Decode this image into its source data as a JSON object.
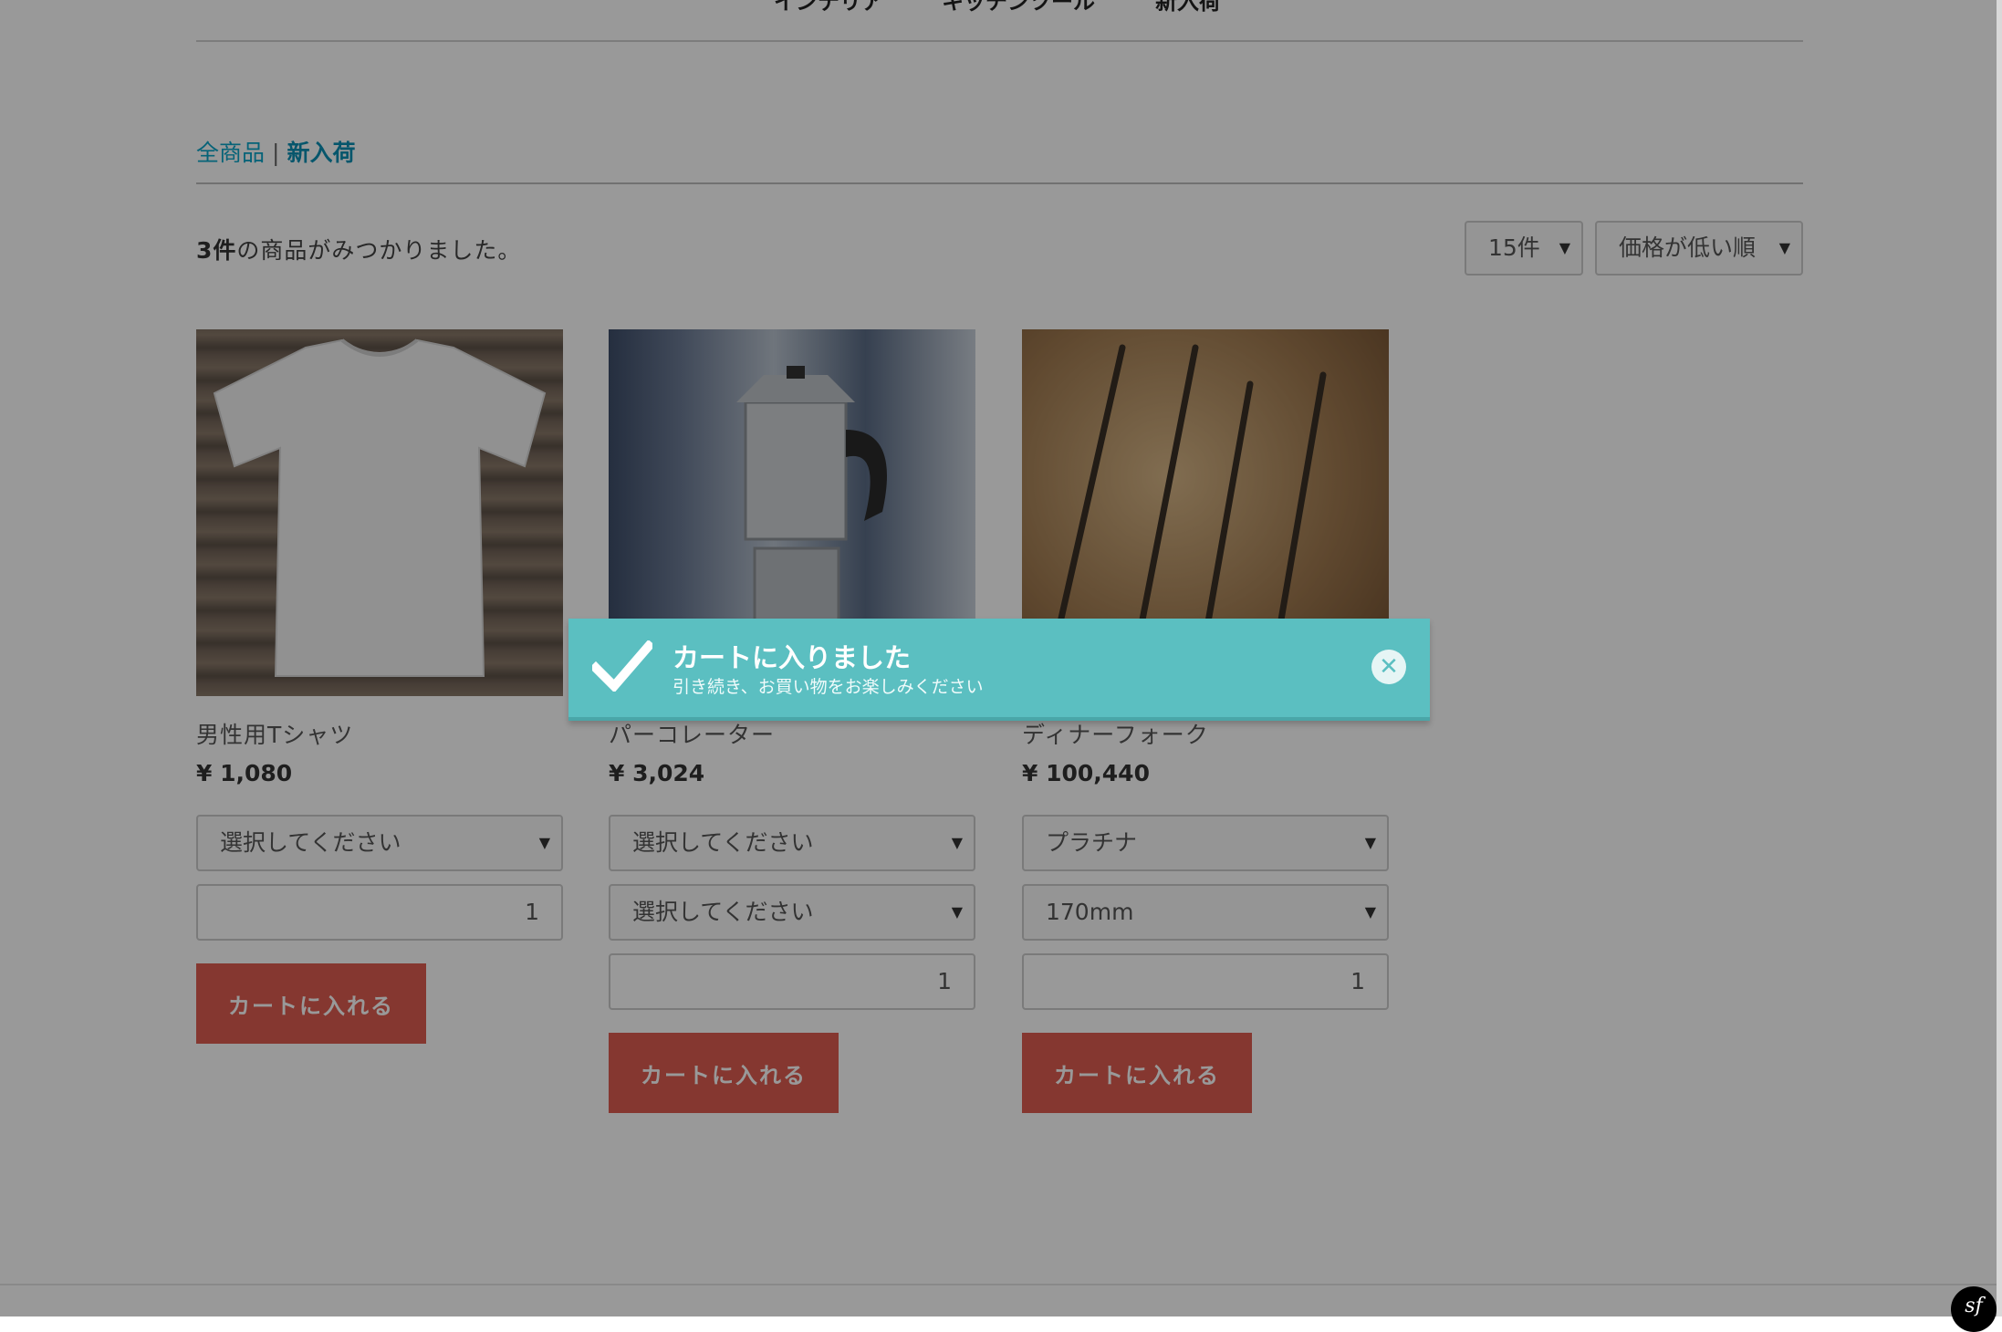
{
  "topnav": {
    "items": [
      "インテリア",
      "キッチンツール",
      "新入荷"
    ]
  },
  "breadcrumb": {
    "all": "全商品",
    "separator": "|",
    "current": "新入荷"
  },
  "results": {
    "count": "3件",
    "suffix": "の商品がみつかりました。"
  },
  "controls": {
    "per_page": "15件",
    "sort": "価格が低い順"
  },
  "products": [
    {
      "name": "男性用Tシャツ",
      "price": "¥ 1,080",
      "select1": "選択してください",
      "quantity": "1",
      "button": "カートに入れる"
    },
    {
      "name": "パーコレーター",
      "price": "¥ 3,024",
      "select1": "選択してください",
      "select2": "選択してください",
      "quantity": "1",
      "button": "カートに入れる"
    },
    {
      "name": "ディナーフォーク",
      "price": "¥ 100,440",
      "select1": "プラチナ",
      "select2": "170mm",
      "quantity": "1",
      "button": "カートに入れる"
    }
  ],
  "modal": {
    "title": "カートに入りました",
    "subtitle": "引き続き、お買い物をお楽しみください",
    "close_icon": "close-icon",
    "check_icon": "check-icon"
  },
  "badge": {
    "label": "sf"
  },
  "colors": {
    "accent": "#de5d50",
    "modal_bg": "#5bbfc1",
    "link": "#0aa5c9"
  }
}
